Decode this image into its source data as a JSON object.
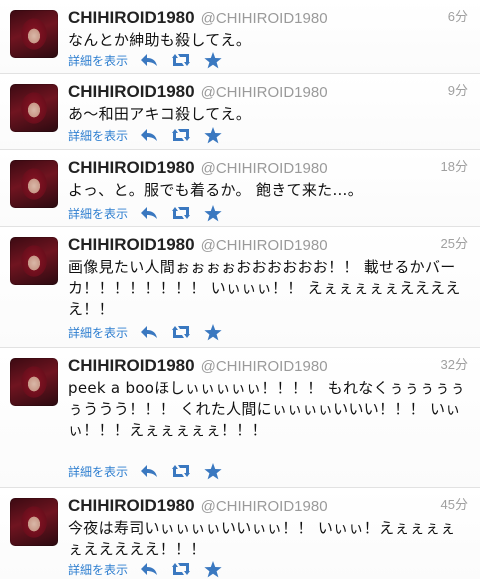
{
  "colors": {
    "link": "#2f7fd0",
    "icon": "#3a78c0",
    "name": "#222222",
    "handle": "#9a9a9a",
    "time": "#a0a0a0"
  },
  "icons": {
    "reply": "reply-icon",
    "retweet": "retweet-icon",
    "favorite": "star-icon"
  },
  "tweets": [
    {
      "name": "CHIHIROID1980",
      "handle": "@CHIHIROID1980",
      "time": "6分",
      "text": "なんとか紳助も殺してえ。",
      "details": "詳細を表示"
    },
    {
      "name": "CHIHIROID1980",
      "handle": "@CHIHIROID1980",
      "time": "9分",
      "text": "あ〜和田アキコ殺してえ。",
      "details": "詳細を表示"
    },
    {
      "name": "CHIHIROID1980",
      "handle": "@CHIHIROID1980",
      "time": "18分",
      "text": "よっ、と。服でも着るか。 飽きて来た…。",
      "details": "詳細を表示"
    },
    {
      "name": "CHIHIROID1980",
      "handle": "@CHIHIROID1980",
      "time": "25分",
      "text": "画像見たい人間ぉぉぉぉおおおおおお！！ 載せるかバーカ！！！！！！！！ いぃぃぃ！！ えぇぇぇぇぇえええええ！！",
      "details": "詳細を表示"
    },
    {
      "name": "CHIHIROID1980",
      "handle": "@CHIHIROID1980",
      "time": "32分",
      "text": "peek a booほしぃぃぃぃぃ！！！！ もれなくぅぅぅぅぅぅううう！！！ くれた人間にぃぃぃぃいいい！！！ いぃぃ！！！えぇぇぇぇぇ！！！",
      "details": "詳細を表示"
    },
    {
      "name": "CHIHIROID1980",
      "handle": "@CHIHIROID1980",
      "time": "45分",
      "text": "今夜は寿司いぃぃぃぃいいぃぃ！！ いぃぃ！えぇぇぇぇぇえええええ！！！",
      "details": "詳細を表示"
    }
  ]
}
